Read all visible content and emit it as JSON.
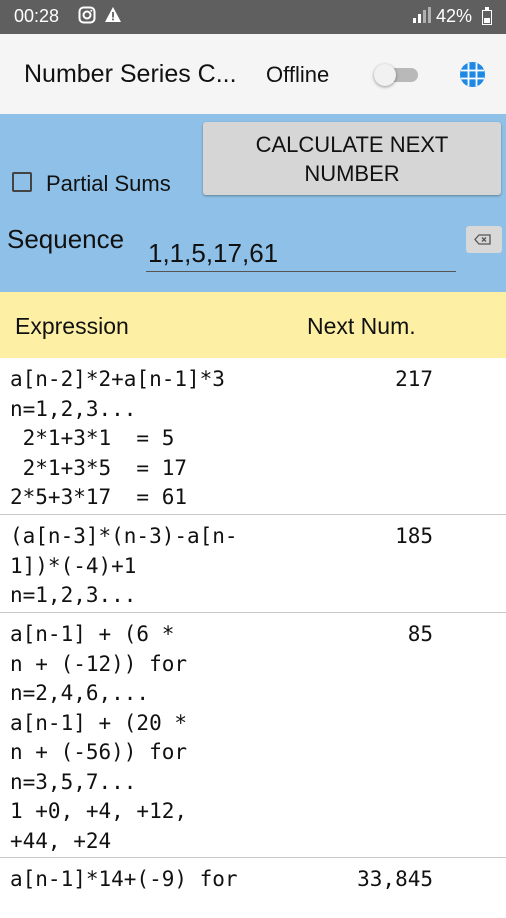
{
  "status_bar": {
    "time": "00:28",
    "icons": [
      "instagram-icon",
      "warning-icon",
      "signal-icon",
      "battery-icon"
    ],
    "battery": "42%"
  },
  "app_bar": {
    "title": "Number Series C...",
    "offline_label": "Offline",
    "offline_toggle_on": false,
    "menu_icon": "globe-icon",
    "accent_color": "#1e88e5"
  },
  "controls": {
    "calculate_button": "CALCULATE NEXT\nNUMBER",
    "partial_sums_label": "Partial Sums",
    "partial_sums_checked": false,
    "sequence_label": "Sequence",
    "sequence_value": "1,1,5,17,61",
    "clear_icon": "backspace-icon",
    "panel_color": "#8fc0e7"
  },
  "table": {
    "header_color": "#fdf0a4",
    "col_expression": "Expression",
    "col_next": "Next Num.",
    "rows": [
      {
        "expression": "a[n-2]*2+a[n-1]*3\nn=1,2,3...\n 2*1+3*1  = 5\n 2*1+3*5  = 17\n2*5+3*17  = 61",
        "next": "217"
      },
      {
        "expression": "(a[n-3]*(n-3)-a[n-\n1])*(-4)+1\nn=1,2,3...",
        "next": "185"
      },
      {
        "expression": "a[n-1] + (6 *\nn + (-12)) for\nn=2,4,6,...\na[n-1] + (20 *\nn + (-56)) for\nn=3,5,7...\n1 +0, +4, +12,\n+44, +24",
        "next": "85"
      },
      {
        "expression": "a[n-1]*14+(-9) for",
        "next": "33,845"
      }
    ]
  }
}
